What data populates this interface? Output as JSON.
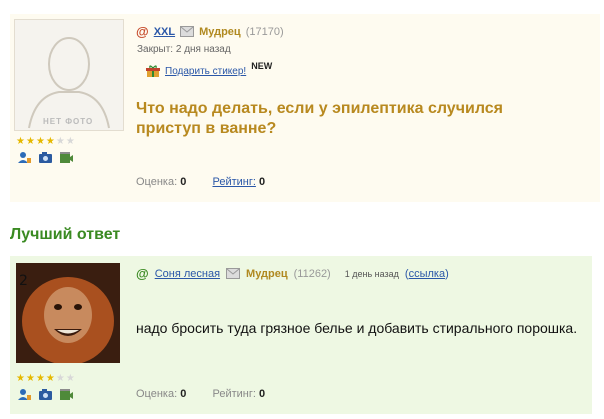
{
  "question": {
    "avatar_caption": "НЕТ ФОТО",
    "author": "XXL",
    "rank": "Мудрец",
    "points": "(17170)",
    "closed_text": "Закрыт: 2 дня назад",
    "gift_label": "Подарить стикер!",
    "new_badge": "NEW",
    "title": "Что надо делать, если у эпилептика случился приступ в ванне?",
    "score_label": "Оценка:",
    "score_value": "0",
    "rating_label": "Рейтинг:",
    "rating_value": "0",
    "stars_filled": 4,
    "stars_total": 6
  },
  "best_answer": {
    "heading": "Лучший ответ",
    "author": "Соня лесная",
    "rank": "Мудрец",
    "points": "(11262)",
    "time": "1 день назад",
    "link_label": "ссылка",
    "text": "надо бросить туда грязное белье и добавить стирального порошка.",
    "score_label": "Оценка:",
    "score_value": "0",
    "rating_label": "Рейтинг:",
    "rating_value": "0",
    "stars_filled": 4,
    "stars_total": 6
  },
  "colors": {
    "question_bg": "#fefbf0",
    "answer_bg": "#eef8e3",
    "title": "#b8891f",
    "heading_green": "#3a8a22",
    "link_blue": "#2a57a8"
  },
  "icons": [
    "at-icon",
    "mail-icon",
    "gift-icon",
    "contact-icon",
    "camera-icon",
    "video-icon"
  ]
}
